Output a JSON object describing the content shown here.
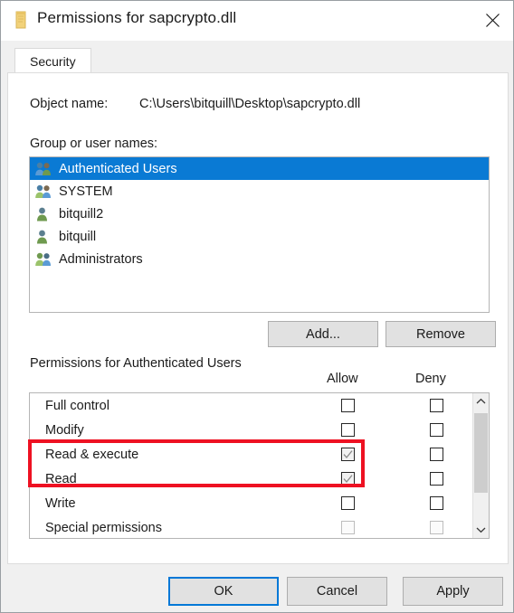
{
  "window": {
    "title": "Permissions for sapcrypto.dll",
    "icon": "file-properties-icon",
    "close_label": "close-icon"
  },
  "tabs": [
    {
      "label": "Security",
      "selected": true
    }
  ],
  "object": {
    "label": "Object name:",
    "value": "C:\\Users\\bitquill\\Desktop\\sapcrypto.dll"
  },
  "group_section": {
    "label": "Group or user names:",
    "entries": [
      {
        "name": "Authenticated Users",
        "icon": "group-icon",
        "selected": true
      },
      {
        "name": "SYSTEM",
        "icon": "group-icon",
        "selected": false
      },
      {
        "name": "bitquill2",
        "icon": "user-icon",
        "selected": false
      },
      {
        "name": "bitquill",
        "icon": "user-icon",
        "selected": false
      },
      {
        "name": "Administrators",
        "icon": "group-icon",
        "selected": false
      }
    ],
    "add_button": "Add...",
    "remove_button": "Remove"
  },
  "permissions_section": {
    "label": "Permissions for Authenticated Users",
    "columns": {
      "allow": "Allow",
      "deny": "Deny"
    },
    "rows": [
      {
        "name": "Full control",
        "allow": false,
        "deny": false,
        "dim": false
      },
      {
        "name": "Modify",
        "allow": false,
        "deny": false,
        "dim": false
      },
      {
        "name": "Read & execute",
        "allow": true,
        "deny": false,
        "dim": false
      },
      {
        "name": "Read",
        "allow": true,
        "deny": false,
        "dim": false
      },
      {
        "name": "Write",
        "allow": false,
        "deny": false,
        "dim": false
      },
      {
        "name": "Special permissions",
        "allow": false,
        "deny": false,
        "dim": true
      }
    ],
    "scrollbar": {
      "up_arrow": "chevron-up-icon",
      "down_arrow": "chevron-down-icon"
    }
  },
  "annotation": {
    "color": "#ee1122",
    "highlights": [
      "Read & execute",
      "Read"
    ]
  },
  "footer": {
    "ok": "OK",
    "cancel": "Cancel",
    "apply": "Apply"
  },
  "colors": {
    "selection_blue": "#0a7ad4",
    "focus_blue": "#0078d7",
    "dialog_bg": "#f0f0f0",
    "annotation_red": "#ee1122"
  }
}
